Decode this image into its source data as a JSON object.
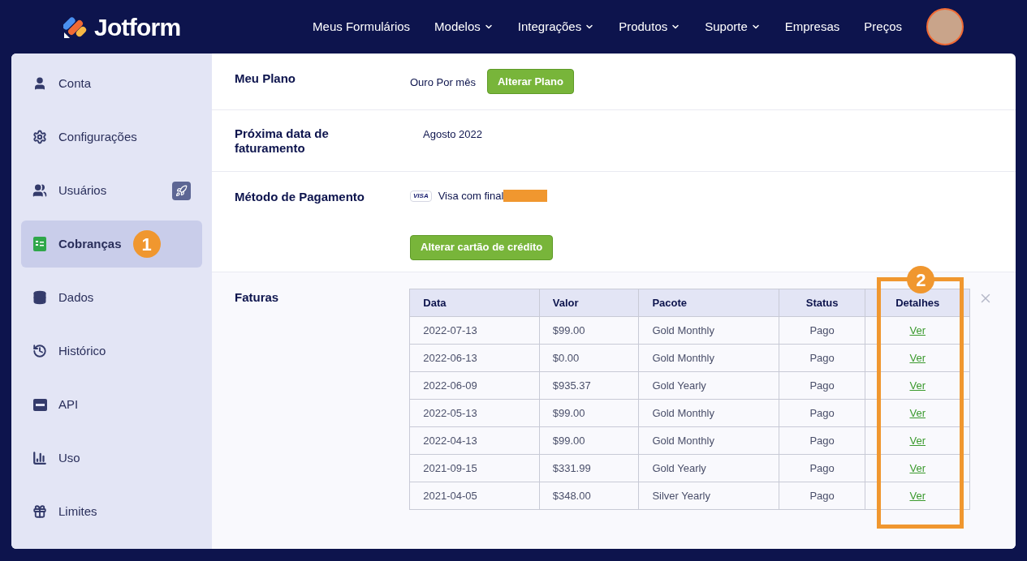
{
  "header": {
    "logo": "Jotform",
    "nav": [
      {
        "label": "Meus Formulários",
        "dropdown": false
      },
      {
        "label": "Modelos",
        "dropdown": true
      },
      {
        "label": "Integrações",
        "dropdown": true
      },
      {
        "label": "Produtos",
        "dropdown": true
      },
      {
        "label": "Suporte",
        "dropdown": true
      },
      {
        "label": "Empresas",
        "dropdown": false
      },
      {
        "label": "Preços",
        "dropdown": false
      }
    ]
  },
  "sidebar": {
    "items": [
      {
        "label": "Conta",
        "selected": false,
        "rocket": false
      },
      {
        "label": "Configurações",
        "selected": false,
        "rocket": false
      },
      {
        "label": "Usuários",
        "selected": false,
        "rocket": true
      },
      {
        "label": "Cobranças",
        "selected": true,
        "rocket": false,
        "callout": "1"
      },
      {
        "label": "Dados",
        "selected": false,
        "rocket": false
      },
      {
        "label": "Histórico",
        "selected": false,
        "rocket": false
      },
      {
        "label": "API",
        "selected": false,
        "rocket": false
      },
      {
        "label": "Uso",
        "selected": false,
        "rocket": false
      },
      {
        "label": "Limites",
        "selected": false,
        "rocket": false
      }
    ]
  },
  "plan": {
    "label": "Meu Plano",
    "value": "Ouro Por mês",
    "button": "Alterar Plano"
  },
  "billing_date": {
    "label": "Próxima data de faturamento",
    "value": "Agosto 2022"
  },
  "payment": {
    "label": "Método de Pagamento",
    "card_brand": "VISA",
    "card_text": "Visa com final",
    "redacted": true,
    "button": "Alterar cartão de crédito"
  },
  "invoices": {
    "label": "Faturas",
    "columns": [
      "Data",
      "Valor",
      "Pacote",
      "Status",
      "Detalhes"
    ],
    "highlight_callout": "2",
    "rows": [
      [
        "2022-07-13",
        "$99.00",
        "Gold Monthly",
        "Pago",
        "Ver"
      ],
      [
        "2022-06-13",
        "$0.00",
        "Gold Monthly",
        "Pago",
        "Ver"
      ],
      [
        "2022-06-09",
        "$935.37",
        "Gold Yearly",
        "Pago",
        "Ver"
      ],
      [
        "2022-05-13",
        "$99.00",
        "Gold Monthly",
        "Pago",
        "Ver"
      ],
      [
        "2022-04-13",
        "$99.00",
        "Gold Monthly",
        "Pago",
        "Ver"
      ],
      [
        "2021-09-15",
        "$331.99",
        "Gold Yearly",
        "Pago",
        "Ver"
      ],
      [
        "2021-04-05",
        "$348.00",
        "Silver Yearly",
        "Pago",
        "Ver"
      ]
    ]
  }
}
